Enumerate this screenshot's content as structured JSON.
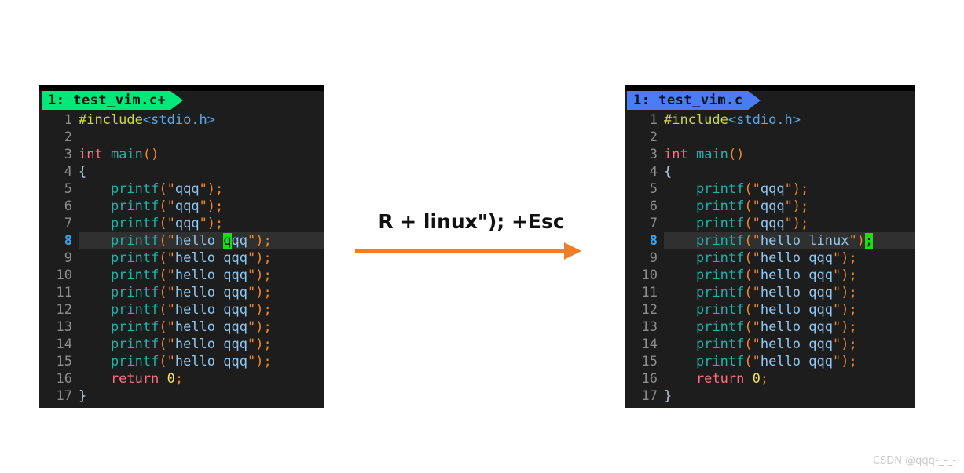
{
  "panels": {
    "left": {
      "tab": {
        "label": "1: test_vim.c+",
        "color": "#00e87a",
        "modified": true
      },
      "current_line": 8,
      "lines": [
        {
          "num": "1",
          "segments": [
            {
              "text": "#include",
              "cls": "t-pre"
            },
            {
              "text": "<stdio.h>",
              "cls": "t-inc"
            }
          ]
        },
        {
          "num": "2",
          "segments": []
        },
        {
          "num": "3",
          "segments": [
            {
              "text": "int ",
              "cls": "t-kw"
            },
            {
              "text": "main",
              "cls": "t-fn"
            },
            {
              "text": "()",
              "cls": "t-punc"
            }
          ]
        },
        {
          "num": "4",
          "segments": [
            {
              "text": "{",
              "cls": "t-brace"
            }
          ]
        },
        {
          "num": "5",
          "segments": [
            {
              "text": "    printf",
              "cls": "t-fn"
            },
            {
              "text": "(\"",
              "cls": "t-punc"
            },
            {
              "text": "qqq",
              "cls": "t-str"
            },
            {
              "text": "\");",
              "cls": "t-punc"
            }
          ]
        },
        {
          "num": "6",
          "segments": [
            {
              "text": "    printf",
              "cls": "t-fn"
            },
            {
              "text": "(\"",
              "cls": "t-punc"
            },
            {
              "text": "qqq",
              "cls": "t-str"
            },
            {
              "text": "\");",
              "cls": "t-punc"
            }
          ]
        },
        {
          "num": "7",
          "segments": [
            {
              "text": "    printf",
              "cls": "t-fn"
            },
            {
              "text": "(\"",
              "cls": "t-punc"
            },
            {
              "text": "qqq",
              "cls": "t-str"
            },
            {
              "text": "\");",
              "cls": "t-punc"
            }
          ]
        },
        {
          "num": "8",
          "current": true,
          "segments": [
            {
              "text": "    printf",
              "cls": "t-fn"
            },
            {
              "text": "(\"",
              "cls": "t-punc"
            },
            {
              "text": "hello ",
              "cls": "t-str"
            },
            {
              "text": "q",
              "cls": "t-str",
              "cursor": true
            },
            {
              "text": "qq",
              "cls": "t-str"
            },
            {
              "text": "\");",
              "cls": "t-punc"
            }
          ]
        },
        {
          "num": "9",
          "segments": [
            {
              "text": "    printf",
              "cls": "t-fn"
            },
            {
              "text": "(\"",
              "cls": "t-punc"
            },
            {
              "text": "hello qqq",
              "cls": "t-str"
            },
            {
              "text": "\");",
              "cls": "t-punc"
            }
          ]
        },
        {
          "num": "10",
          "segments": [
            {
              "text": "    printf",
              "cls": "t-fn"
            },
            {
              "text": "(\"",
              "cls": "t-punc"
            },
            {
              "text": "hello qqq",
              "cls": "t-str"
            },
            {
              "text": "\");",
              "cls": "t-punc"
            }
          ]
        },
        {
          "num": "11",
          "segments": [
            {
              "text": "    printf",
              "cls": "t-fn"
            },
            {
              "text": "(\"",
              "cls": "t-punc"
            },
            {
              "text": "hello qqq",
              "cls": "t-str"
            },
            {
              "text": "\");",
              "cls": "t-punc"
            }
          ]
        },
        {
          "num": "12",
          "segments": [
            {
              "text": "    printf",
              "cls": "t-fn"
            },
            {
              "text": "(\"",
              "cls": "t-punc"
            },
            {
              "text": "hello qqq",
              "cls": "t-str"
            },
            {
              "text": "\");",
              "cls": "t-punc"
            }
          ]
        },
        {
          "num": "13",
          "segments": [
            {
              "text": "    printf",
              "cls": "t-fn"
            },
            {
              "text": "(\"",
              "cls": "t-punc"
            },
            {
              "text": "hello qqq",
              "cls": "t-str"
            },
            {
              "text": "\");",
              "cls": "t-punc"
            }
          ]
        },
        {
          "num": "14",
          "segments": [
            {
              "text": "    printf",
              "cls": "t-fn"
            },
            {
              "text": "(\"",
              "cls": "t-punc"
            },
            {
              "text": "hello qqq",
              "cls": "t-str"
            },
            {
              "text": "\");",
              "cls": "t-punc"
            }
          ]
        },
        {
          "num": "15",
          "segments": [
            {
              "text": "    printf",
              "cls": "t-fn"
            },
            {
              "text": "(\"",
              "cls": "t-punc"
            },
            {
              "text": "hello qqq",
              "cls": "t-str"
            },
            {
              "text": "\");",
              "cls": "t-punc"
            }
          ]
        },
        {
          "num": "16",
          "segments": [
            {
              "text": "    return ",
              "cls": "t-kw"
            },
            {
              "text": "0",
              "cls": "t-num"
            },
            {
              "text": ";",
              "cls": "t-punc"
            }
          ]
        },
        {
          "num": "17",
          "segments": [
            {
              "text": "}",
              "cls": "t-brace"
            }
          ]
        }
      ]
    },
    "right": {
      "tab": {
        "label": "1: test_vim.c",
        "color": "#4a7cf5",
        "modified": false
      },
      "current_line": 8,
      "lines": [
        {
          "num": "1",
          "segments": [
            {
              "text": "#include",
              "cls": "t-pre"
            },
            {
              "text": "<stdio.h>",
              "cls": "t-inc"
            }
          ]
        },
        {
          "num": "2",
          "segments": []
        },
        {
          "num": "3",
          "segments": [
            {
              "text": "int ",
              "cls": "t-kw"
            },
            {
              "text": "main",
              "cls": "t-fn"
            },
            {
              "text": "()",
              "cls": "t-punc"
            }
          ]
        },
        {
          "num": "4",
          "segments": [
            {
              "text": "{",
              "cls": "t-brace"
            }
          ]
        },
        {
          "num": "5",
          "segments": [
            {
              "text": "    printf",
              "cls": "t-fn"
            },
            {
              "text": "(\"",
              "cls": "t-punc"
            },
            {
              "text": "qqq",
              "cls": "t-str"
            },
            {
              "text": "\");",
              "cls": "t-punc"
            }
          ]
        },
        {
          "num": "6",
          "segments": [
            {
              "text": "    printf",
              "cls": "t-fn"
            },
            {
              "text": "(\"",
              "cls": "t-punc"
            },
            {
              "text": "qqq",
              "cls": "t-str"
            },
            {
              "text": "\");",
              "cls": "t-punc"
            }
          ]
        },
        {
          "num": "7",
          "segments": [
            {
              "text": "    printf",
              "cls": "t-fn"
            },
            {
              "text": "(\"",
              "cls": "t-punc"
            },
            {
              "text": "qqq",
              "cls": "t-str"
            },
            {
              "text": "\");",
              "cls": "t-punc"
            }
          ]
        },
        {
          "num": "8",
          "current": true,
          "segments": [
            {
              "text": "    printf",
              "cls": "t-fn"
            },
            {
              "text": "(\"",
              "cls": "t-punc"
            },
            {
              "text": "hello linux",
              "cls": "t-str"
            },
            {
              "text": "\")",
              "cls": "t-punc"
            },
            {
              "text": ";",
              "cls": "t-punc",
              "cursor": true
            }
          ]
        },
        {
          "num": "9",
          "segments": [
            {
              "text": "    printf",
              "cls": "t-fn"
            },
            {
              "text": "(\"",
              "cls": "t-punc"
            },
            {
              "text": "hello qqq",
              "cls": "t-str"
            },
            {
              "text": "\");",
              "cls": "t-punc"
            }
          ]
        },
        {
          "num": "10",
          "segments": [
            {
              "text": "    printf",
              "cls": "t-fn"
            },
            {
              "text": "(\"",
              "cls": "t-punc"
            },
            {
              "text": "hello qqq",
              "cls": "t-str"
            },
            {
              "text": "\");",
              "cls": "t-punc"
            }
          ]
        },
        {
          "num": "11",
          "segments": [
            {
              "text": "    printf",
              "cls": "t-fn"
            },
            {
              "text": "(\"",
              "cls": "t-punc"
            },
            {
              "text": "hello qqq",
              "cls": "t-str"
            },
            {
              "text": "\");",
              "cls": "t-punc"
            }
          ]
        },
        {
          "num": "12",
          "segments": [
            {
              "text": "    printf",
              "cls": "t-fn"
            },
            {
              "text": "(\"",
              "cls": "t-punc"
            },
            {
              "text": "hello qqq",
              "cls": "t-str"
            },
            {
              "text": "\");",
              "cls": "t-punc"
            }
          ]
        },
        {
          "num": "13",
          "segments": [
            {
              "text": "    printf",
              "cls": "t-fn"
            },
            {
              "text": "(\"",
              "cls": "t-punc"
            },
            {
              "text": "hello qqq",
              "cls": "t-str"
            },
            {
              "text": "\");",
              "cls": "t-punc"
            }
          ]
        },
        {
          "num": "14",
          "segments": [
            {
              "text": "    printf",
              "cls": "t-fn"
            },
            {
              "text": "(\"",
              "cls": "t-punc"
            },
            {
              "text": "hello qqq",
              "cls": "t-str"
            },
            {
              "text": "\");",
              "cls": "t-punc"
            }
          ]
        },
        {
          "num": "15",
          "segments": [
            {
              "text": "    printf",
              "cls": "t-fn"
            },
            {
              "text": "(\"",
              "cls": "t-punc"
            },
            {
              "text": "hello qqq",
              "cls": "t-str"
            },
            {
              "text": "\");",
              "cls": "t-punc"
            }
          ]
        },
        {
          "num": "16",
          "segments": [
            {
              "text": "    return ",
              "cls": "t-kw"
            },
            {
              "text": "0",
              "cls": "t-num"
            },
            {
              "text": ";",
              "cls": "t-punc"
            }
          ]
        },
        {
          "num": "17",
          "segments": [
            {
              "text": "}",
              "cls": "t-brace"
            }
          ]
        }
      ]
    }
  },
  "annotation": {
    "text": "R + linux\"); +Esc",
    "arrow_color": "#f07e26",
    "icon": "right-arrow-icon"
  },
  "watermark": {
    "text": "CSDN @qqq-_-_-"
  }
}
